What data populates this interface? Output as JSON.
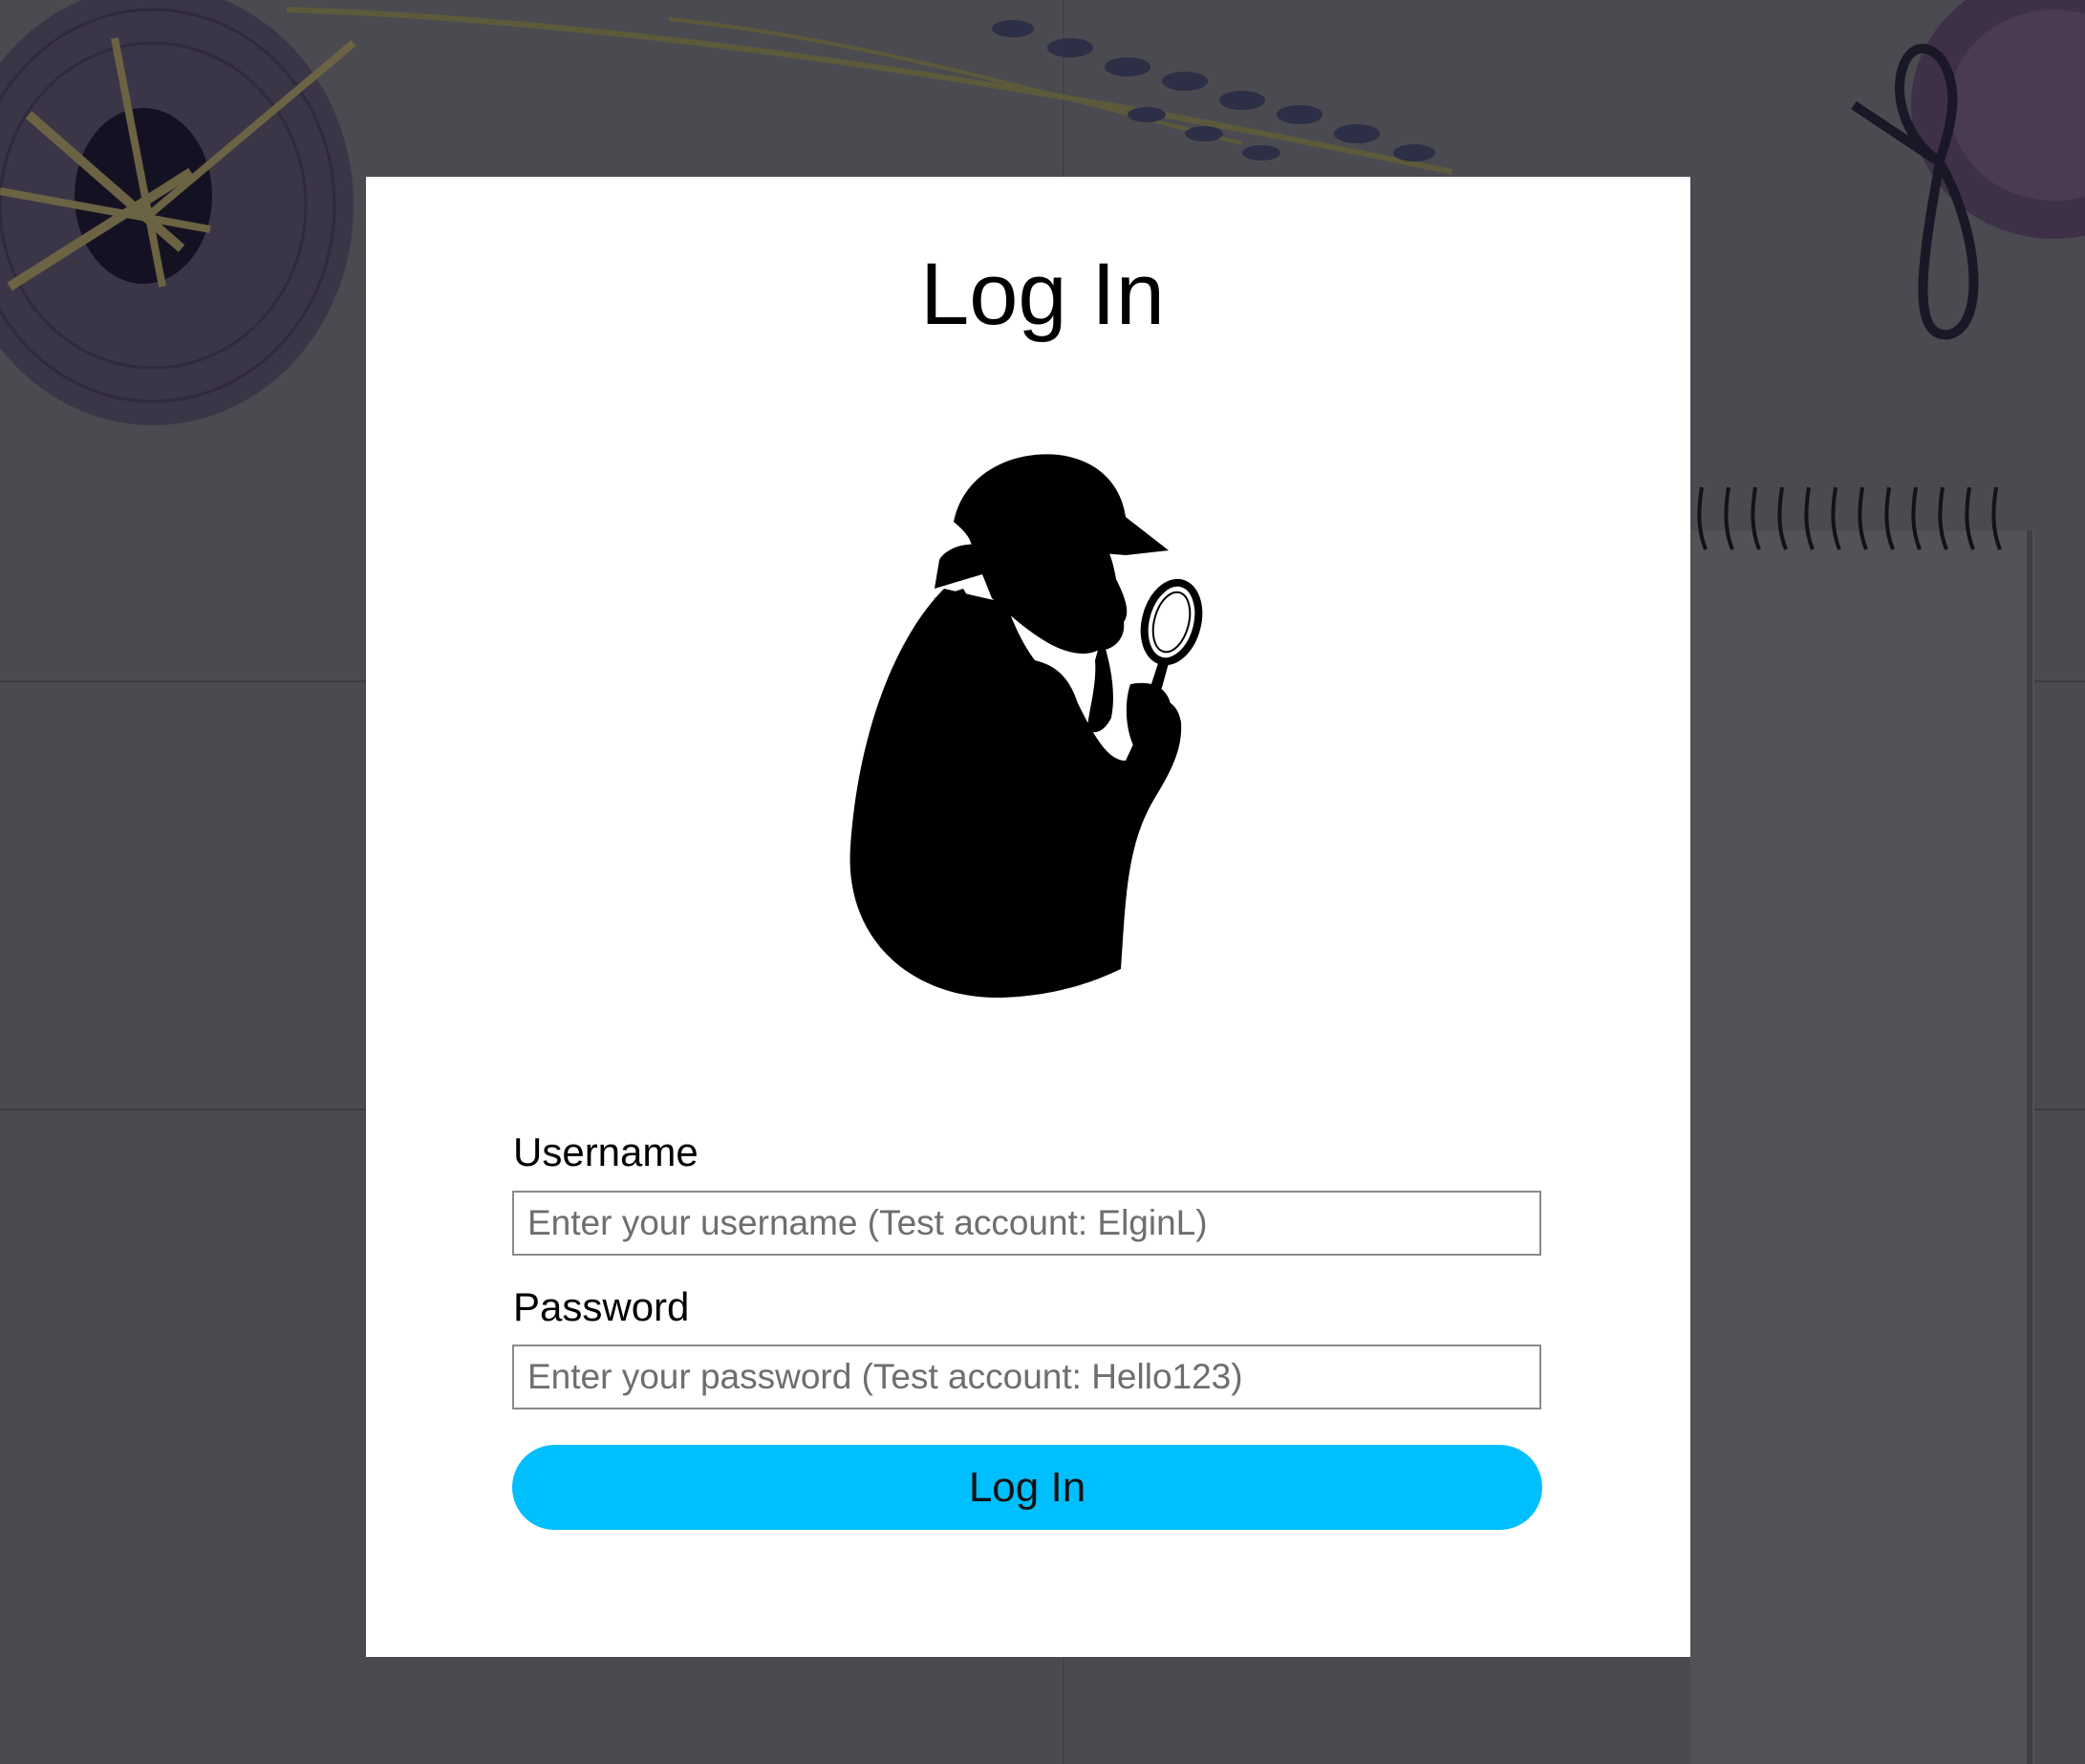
{
  "colors": {
    "background": "#4a4a50",
    "card": "#ffffff",
    "button": "#00bfff"
  },
  "login_form": {
    "title": "Log In",
    "illustration": "detective-silhouette-icon",
    "username_label": "Username",
    "username_placeholder": "Enter your username (Test account: ElginL)",
    "username_value": "",
    "password_label": "Password",
    "password_placeholder": "Enter your password (Test account: Hello123)",
    "password_value": "",
    "submit_label": "Log In"
  }
}
